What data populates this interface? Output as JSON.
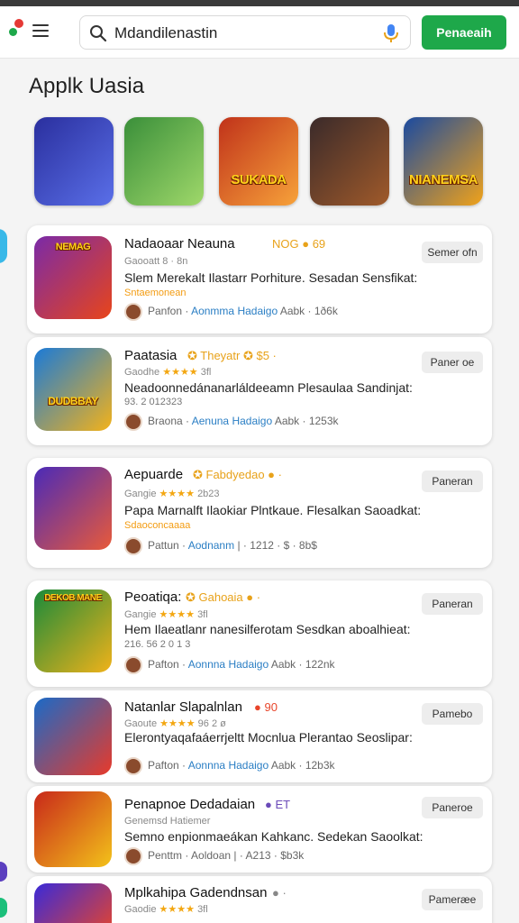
{
  "header": {
    "search_value": "Mdandilenastin",
    "search_button": "Penaeaih"
  },
  "section_title": "Applk Uasia",
  "featured": [
    {
      "label": "",
      "colors": [
        "#2a2f9e",
        "#5a6fe8"
      ]
    },
    {
      "label": "",
      "colors": [
        "#3a8f3a",
        "#9fd86a"
      ]
    },
    {
      "label": "SUKADA",
      "colors": [
        "#c0321a",
        "#f7a23a"
      ]
    },
    {
      "label": "",
      "colors": [
        "#3a2a2a",
        "#a05a2a"
      ]
    },
    {
      "label": "NIANEMSA",
      "colors": [
        "#1a4aa0",
        "#f0a21a"
      ]
    }
  ],
  "cards": [
    {
      "title": "Nadaoaar Neauna",
      "badge": "NOG ● 69",
      "sub_prefix": "Gaooatt",
      "stars": "",
      "sub_suffix": "8 · 8n",
      "desc": "Slem Merekalt Ilastarr Porhiture. Sesadan Sensfikat:",
      "extra": "Sntaemonean",
      "meta_name": "Panfon",
      "meta_link1": "Aonmma",
      "meta_link2": "Hadaigo",
      "meta_suffix": "Aabk · 1ð6k",
      "button": "Semer ofn",
      "icon_text": "NEMAG",
      "icon_colors": [
        "#7a2aa8",
        "#e8451a"
      ]
    },
    {
      "title": "Paatasia",
      "badge": "✪ Theyatr ✪ $5 ·",
      "sub_prefix": "Gaodhe",
      "stars": "★★★★",
      "sub_suffix": "3fl",
      "desc": "Neadoonnedánanarláldeeamn Plesaulaa Sandinjat:",
      "extra": "93. 2 012323",
      "meta_name": "Braona",
      "meta_link1": "Aenuna",
      "meta_link2": "Hadaigo",
      "meta_suffix": "Aabk · 1253k",
      "button": "Paner oe",
      "icon_text": "DUDBBAY",
      "icon_colors": [
        "#1a7ad8",
        "#f3b21a"
      ]
    },
    {
      "title": "Aepuarde",
      "badge": "✪ Fabdyedao ● ·",
      "sub_prefix": "Gangie",
      "stars": "★★★★",
      "sub_suffix": "2b23",
      "desc": "Papa Marnalft Ilaokiar Plntkaue. Flesalkan Saoadkat:",
      "extra": "Sdaoconcaaaa",
      "meta_name": "Pattun",
      "meta_link1": "Aodnanm",
      "meta_link2": "",
      "meta_suffix": "| · 1212 · $ · 8b$",
      "button": "Paneran",
      "icon_text": "",
      "icon_colors": [
        "#4a2ab8",
        "#e85a3a"
      ]
    },
    {
      "title": "Peoatiqa:",
      "badge": "✪ Gahoaia ● ·",
      "sub_prefix": "Gangie",
      "stars": "★★★★",
      "sub_suffix": "3fl",
      "desc": "Hem Ilaeatlanr nanesilferotam Sesdkan aboalhieat:",
      "extra": "216. 56 2 0 1 3",
      "meta_name": "Pafton",
      "meta_link1": "Aonnna",
      "meta_link2": "Hadaigo",
      "meta_suffix": "Aabk · 122nk",
      "button": "Paneran",
      "icon_text": "DEKOB MANE",
      "icon_colors": [
        "#1a8a3a",
        "#f0b21a"
      ]
    },
    {
      "title": "Natanlar Slapalnlan",
      "badge": "● 90",
      "sub_prefix": "Gaoute",
      "stars": "★★★★",
      "sub_suffix": "96 2 ø",
      "desc": "Elerontyaqafaáerrjeltt Mocnlua Plerantao Seoslipar:",
      "extra": "",
      "meta_name": "Pafton",
      "meta_link1": "Aonnna",
      "meta_link2": "Hadaigo",
      "meta_suffix": "Aabk · 12b3k",
      "button": "Pamebo",
      "icon_text": "",
      "icon_colors": [
        "#1a6ac8",
        "#e83a2a"
      ]
    },
    {
      "title": "Penapnoe Dedadaian",
      "badge": "● ET",
      "sub_prefix": "Genemsd",
      "stars": "",
      "sub_suffix": "Hatiemer",
      "desc": "Semno enpionmaeákan Kahkanc. Sedekan Saoolkat:",
      "extra": "",
      "meta_name": "Penttm",
      "meta_link1": "",
      "meta_link2": "Aoldoan",
      "meta_suffix": "| · A213 · $b3k",
      "button": "Paneroe",
      "icon_text": "",
      "icon_colors": [
        "#c8281a",
        "#f3c21a"
      ]
    },
    {
      "title": "Mplkahipa Gadendnsan",
      "badge": "● ·",
      "sub_prefix": "Gaodie",
      "stars": "★★★★",
      "sub_suffix": "3fl",
      "desc": "",
      "extra": "",
      "meta_name": "",
      "meta_link1": "",
      "meta_link2": "",
      "meta_suffix": "",
      "button": "Pameræe",
      "icon_text": "",
      "icon_colors": [
        "#3a2ad8",
        "#e8452a"
      ]
    }
  ]
}
